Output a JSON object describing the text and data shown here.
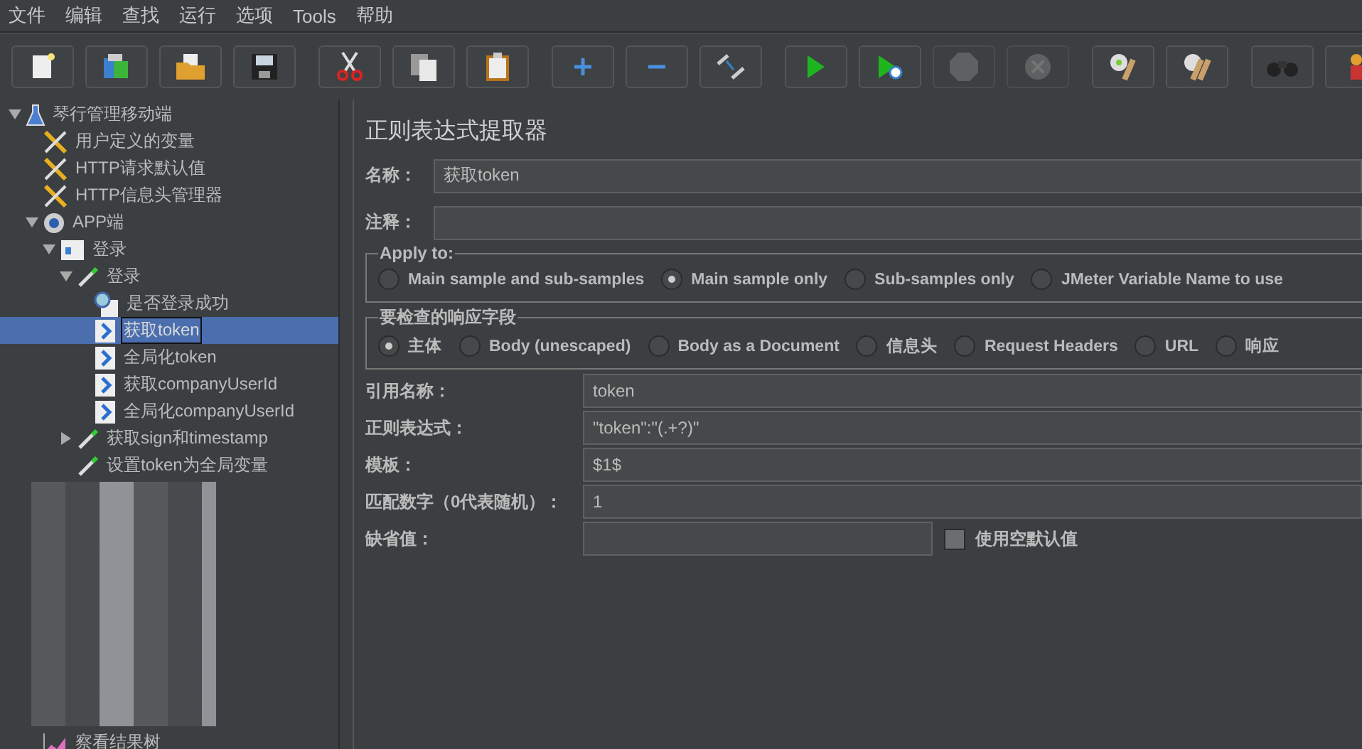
{
  "menu": [
    "文件",
    "编辑",
    "查找",
    "运行",
    "选项",
    "Tools",
    "帮助"
  ],
  "toolbar": [
    [
      {
        "kind": "new",
        "disabled": false
      },
      {
        "kind": "templates",
        "disabled": false
      },
      {
        "kind": "open",
        "disabled": false
      },
      {
        "kind": "save",
        "disabled": false
      }
    ],
    [
      {
        "kind": "cut",
        "disabled": false
      },
      {
        "kind": "copy",
        "disabled": false
      },
      {
        "kind": "paste",
        "disabled": false
      }
    ],
    [
      {
        "kind": "add",
        "disabled": false
      },
      {
        "kind": "remove",
        "disabled": false
      },
      {
        "kind": "toggle",
        "disabled": false
      }
    ],
    [
      {
        "kind": "start",
        "disabled": false
      },
      {
        "kind": "start-no-pause",
        "disabled": false
      },
      {
        "kind": "stop",
        "disabled": true
      },
      {
        "kind": "shutdown",
        "disabled": true
      }
    ],
    [
      {
        "kind": "clear",
        "disabled": false
      },
      {
        "kind": "clear-all",
        "disabled": false
      }
    ],
    [
      {
        "kind": "search",
        "disabled": false
      },
      {
        "kind": "reset",
        "disabled": false
      }
    ]
  ],
  "tree": [
    {
      "label": "琴行管理移动端",
      "kind": "testplan",
      "expanded": true,
      "selected": false,
      "children": [
        {
          "label": "用户定义的变量",
          "kind": "config",
          "selected": false
        },
        {
          "label": "HTTP请求默认值",
          "kind": "config",
          "selected": false
        },
        {
          "label": "HTTP信息头管理器",
          "kind": "config",
          "selected": false
        },
        {
          "label": "APP端",
          "kind": "threadgroup",
          "expanded": true,
          "selected": false,
          "children": [
            {
              "label": "登录",
              "kind": "controller",
              "expanded": true,
              "selected": false,
              "children": [
                {
                  "label": "登录",
                  "kind": "sampler",
                  "expanded": true,
                  "selected": false,
                  "children": [
                    {
                      "label": "是否登录成功",
                      "kind": "assertion",
                      "selected": false
                    },
                    {
                      "label": "获取token",
                      "kind": "extractor",
                      "selected": true
                    },
                    {
                      "label": "全局化token",
                      "kind": "extractor",
                      "selected": false
                    },
                    {
                      "label": "获取companyUserId",
                      "kind": "extractor",
                      "selected": false
                    },
                    {
                      "label": "全局化companyUserId",
                      "kind": "extractor",
                      "selected": false
                    }
                  ]
                },
                {
                  "label": "获取sign和timestamp",
                  "kind": "sampler",
                  "expanded": false,
                  "selected": false
                },
                {
                  "label": "设置token为全局变量",
                  "kind": "sampler",
                  "selected": false
                }
              ]
            }
          ]
        },
        {
          "kind": "redacted"
        },
        {
          "label": "察看结果树",
          "kind": "listener",
          "selected": false
        }
      ]
    }
  ],
  "editor": {
    "title": "正则表达式提取器",
    "name": {
      "label": "名称：",
      "value": "获取token"
    },
    "comment": {
      "label": "注释："
    },
    "apply_to": {
      "legend": "Apply to:",
      "options": [
        {
          "label": "Main sample and sub-samples",
          "selected": false
        },
        {
          "label": "Main sample only",
          "selected": true
        },
        {
          "label": "Sub-samples only",
          "selected": false
        },
        {
          "label": "JMeter Variable Name to use",
          "selected": false
        }
      ]
    },
    "field_to_check": {
      "legend": "要检查的响应字段",
      "options": [
        {
          "label": "主体",
          "selected": true
        },
        {
          "label": "Body (unescaped)",
          "selected": false
        },
        {
          "label": "Body as a Document",
          "selected": false
        },
        {
          "label": "信息头",
          "selected": false
        },
        {
          "label": "Request Headers",
          "selected": false
        },
        {
          "label": "URL",
          "selected": false
        },
        {
          "label": "响应",
          "selected": false
        }
      ]
    },
    "fields": [
      {
        "label": "引用名称：",
        "value": "token"
      },
      {
        "label": "正则表达式：",
        "value": "\"token\":\"(.+?)\""
      },
      {
        "label": "模板：",
        "value": "$1$"
      },
      {
        "label": "匹配数字（0代表随机）：",
        "value": "1"
      },
      {
        "label": "缺省值：",
        "checkbox": {
          "label": "使用空默认值",
          "checked": false
        }
      }
    ]
  }
}
